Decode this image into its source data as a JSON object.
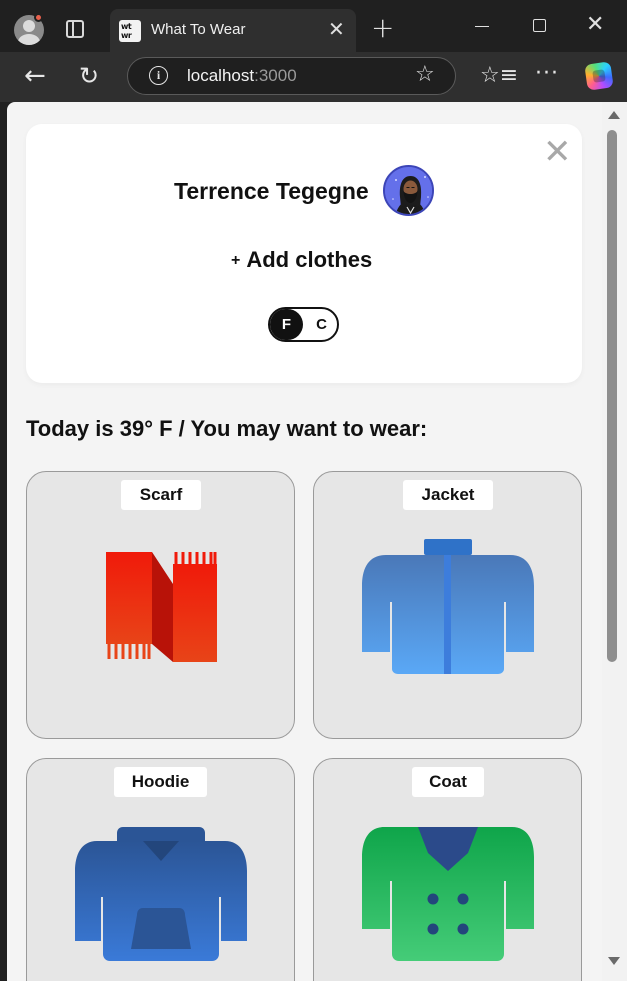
{
  "browser": {
    "tab_title": "What To Wear",
    "favicon_text": "wt wr",
    "url_host": "localhost",
    "url_port": ":3000"
  },
  "profile": {
    "name": "Terrence Tegegne",
    "add_clothes_label": "Add clothes",
    "add_clothes_icon": "+",
    "units": {
      "fahrenheit": "F",
      "celsius": "C",
      "selected": "F"
    },
    "avatar_color": "#6470EA"
  },
  "weather": {
    "summary": "Today is 39° F / You may want to wear:"
  },
  "items": [
    {
      "name": "Scarf",
      "icon": "scarf-icon"
    },
    {
      "name": "Jacket",
      "icon": "jacket-icon"
    },
    {
      "name": "Hoodie",
      "icon": "hoodie-icon"
    },
    {
      "name": "Coat",
      "icon": "coat-icon"
    }
  ]
}
